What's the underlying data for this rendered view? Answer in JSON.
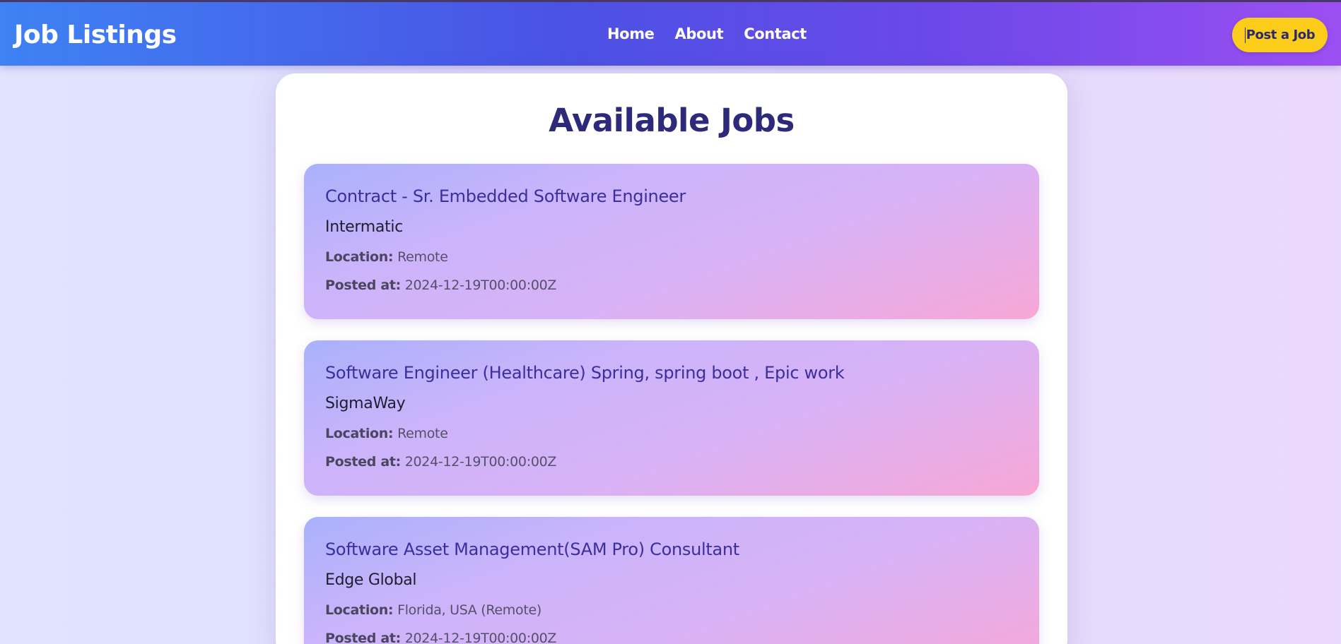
{
  "header": {
    "brand": "Job Listings",
    "nav": [
      "Home",
      "About",
      "Contact"
    ],
    "post_button": "Post a Job"
  },
  "main": {
    "title": "Available Jobs",
    "location_label": "Location:",
    "posted_label": "Posted at:",
    "jobs": [
      {
        "title": "Contract - Sr. Embedded Software Engineer",
        "company": "Intermatic",
        "location": "Remote",
        "posted_at": "2024-12-19T00:00:00Z"
      },
      {
        "title": "Software Engineer (Healthcare) Spring, spring boot , Epic work",
        "company": "SigmaWay",
        "location": "Remote",
        "posted_at": "2024-12-19T00:00:00Z"
      },
      {
        "title": "Software Asset Management(SAM Pro) Consultant",
        "company": "Edge Global",
        "location": "Florida, USA (Remote)",
        "posted_at": "2024-12-19T00:00:00Z"
      }
    ]
  },
  "colors": {
    "header_start": "#3e82f4",
    "header_end": "#9b4ff2",
    "button": "#fbcc1a",
    "title": "#2e2a7a",
    "job_title": "#3a2f9c"
  }
}
